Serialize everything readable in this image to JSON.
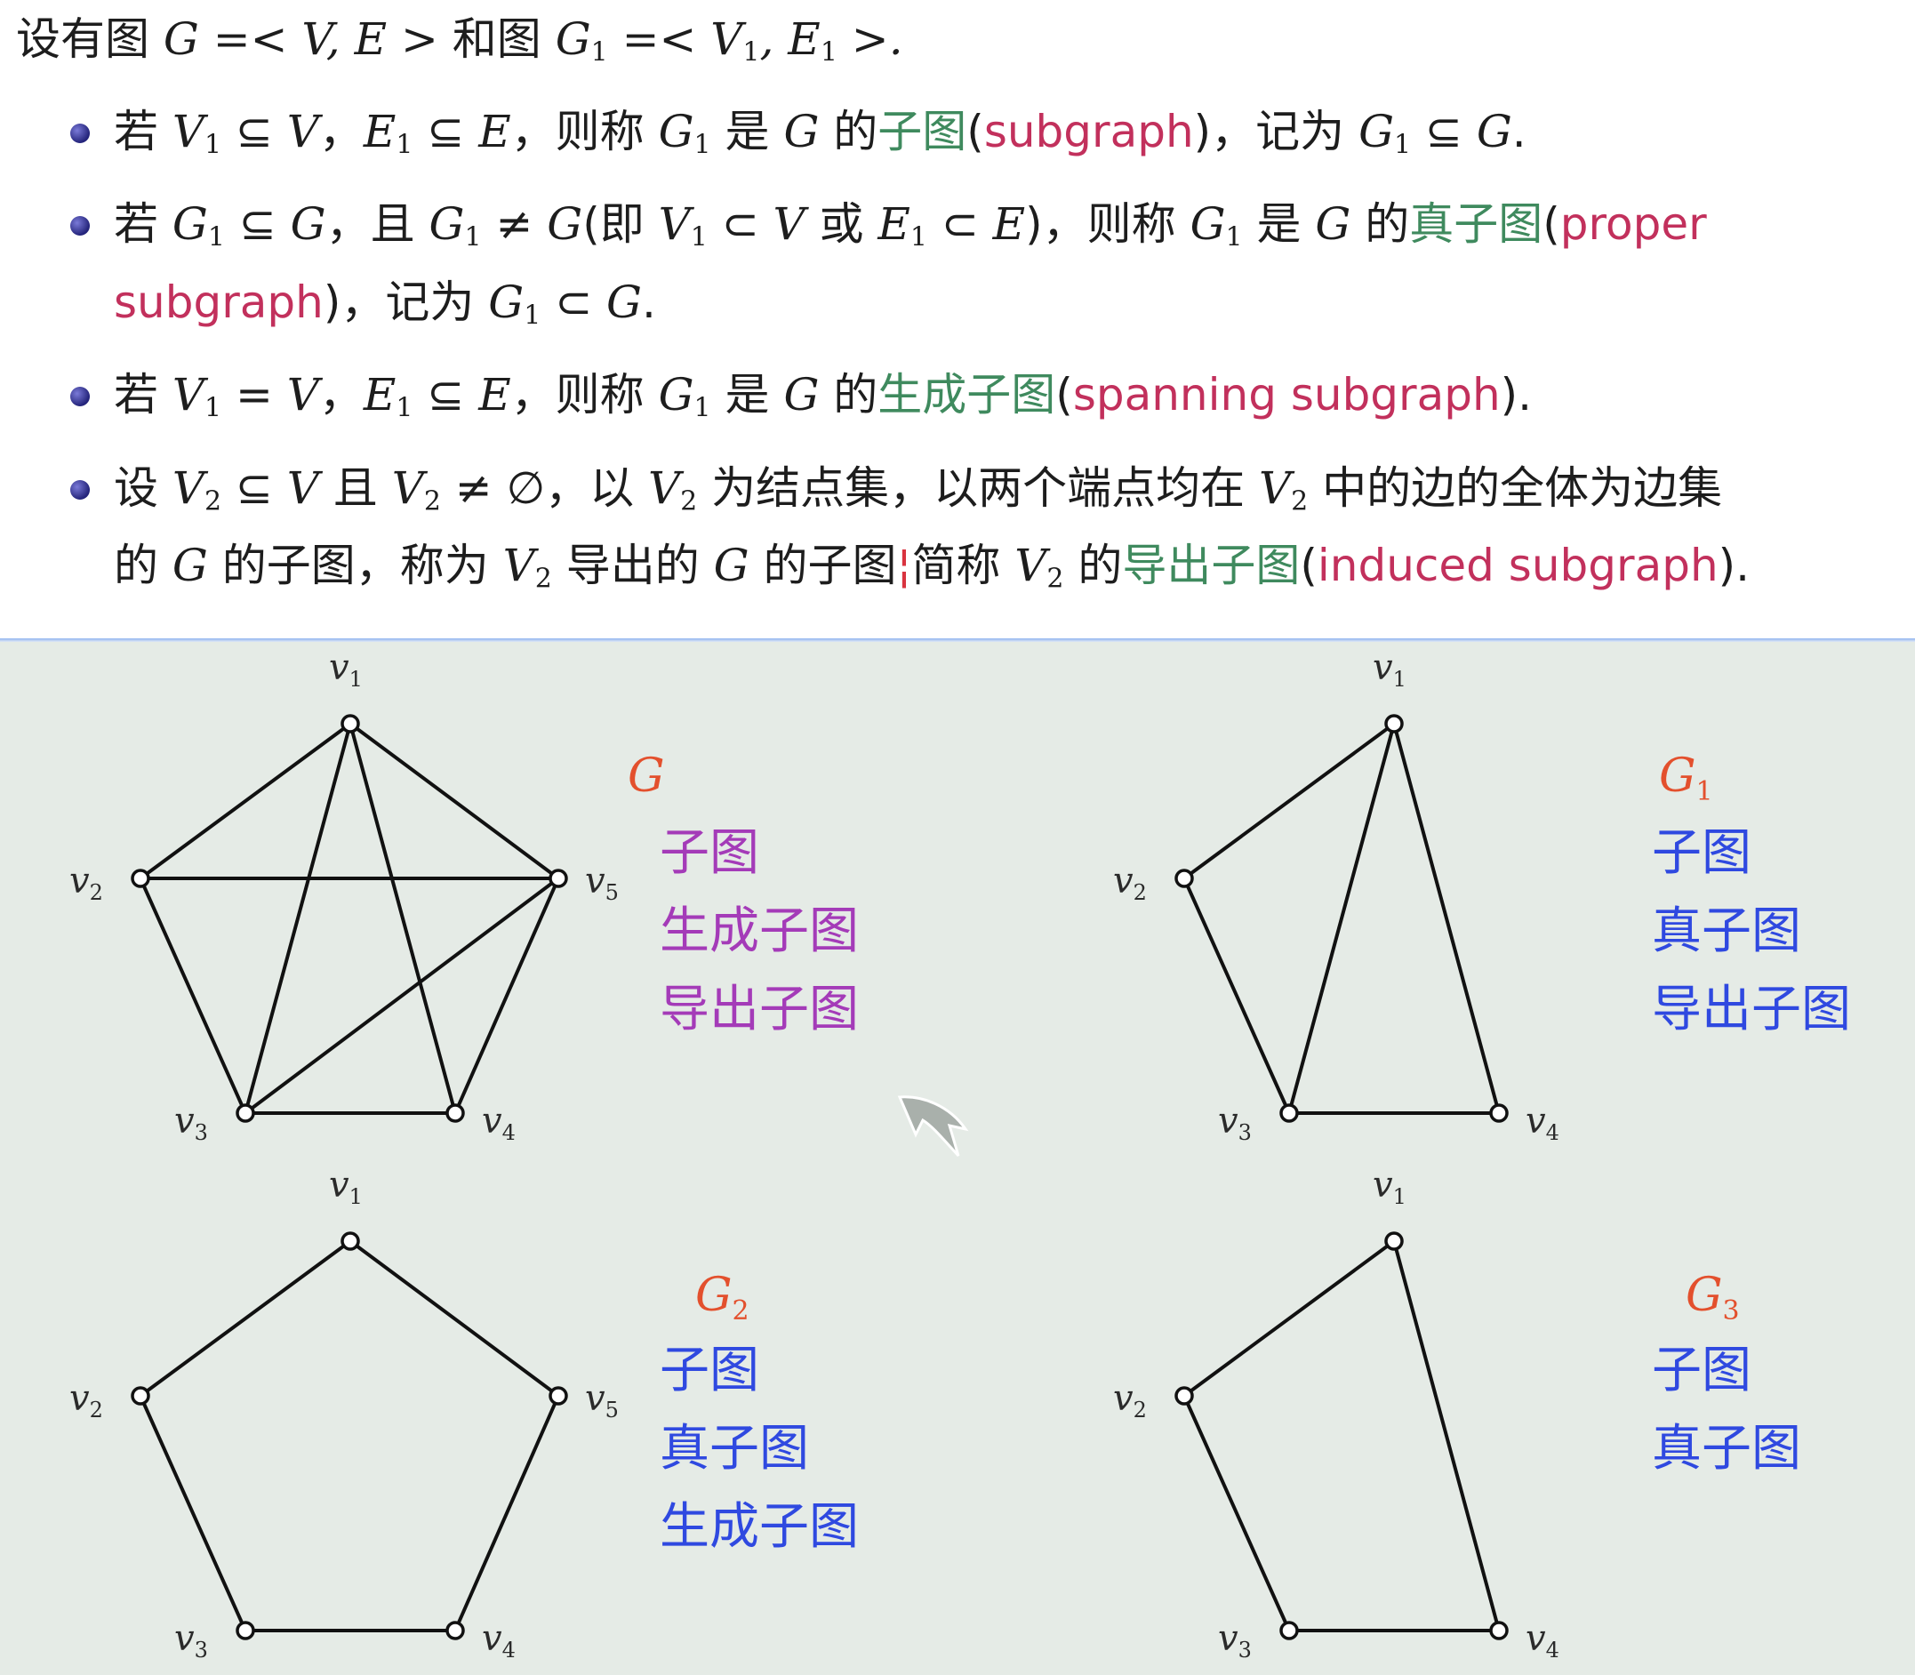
{
  "definition": {
    "intro": {
      "prefix": "设有图",
      "g_def": "G =< V, E >",
      "and": "和图",
      "g1_def_a": "G",
      "g1_sub": "1",
      "g1_def_b": " =< V",
      "g1_sub2": "1",
      "g1_def_c": ", E",
      "g1_sub3": "1",
      "g1_def_d": " >."
    },
    "items": [
      {
        "p1": "若 ",
        "m1": "V",
        "s1": "1",
        "p2": " ⊆ ",
        "m2": "V",
        "p3": "，",
        "m3": "E",
        "s3": "1",
        "p4": " ⊆ ",
        "m4": "E",
        "p5": "，则称 ",
        "m5": "G",
        "s5": "1",
        "p6": " 是 ",
        "m6": "G",
        "p7": " 的",
        "term": "子图",
        "eng_open": "(",
        "eng": "subgraph",
        "eng_close": ")",
        "p8": "，记为 ",
        "m8": "G",
        "s8": "1",
        "p9": " ⊆ ",
        "m9": "G",
        "p10": "."
      },
      {
        "line1": {
          "p1": "若 ",
          "m1": "G",
          "s1": "1",
          "p2": " ⊆ ",
          "m2": "G",
          "p3": "，且 ",
          "m3": "G",
          "s3": "1",
          "p4": " ≠ ",
          "m4": "G",
          "p5": "(即 ",
          "m5": "V",
          "s5": "1",
          "p6": " ⊂ ",
          "m6": "V",
          "p7": " 或 ",
          "m7": "E",
          "s7": "1",
          "p8": " ⊂ ",
          "m8": "E",
          "p9": ")，则称 ",
          "m9": "G",
          "s9": "1",
          "p10": " 是 ",
          "m10": "G",
          "p11": " 的",
          "term": "真子图",
          "eng_open": "(",
          "eng": "proper"
        },
        "line2": {
          "eng": "subgraph",
          "eng_close": ")",
          "p1": "，记为 ",
          "m1": "G",
          "s1": "1",
          "p2": " ⊂ ",
          "m2": "G",
          "p3": "."
        }
      },
      {
        "p1": "若 ",
        "m1": "V",
        "s1": "1",
        "p2": " = ",
        "m2": "V",
        "p3": "，",
        "m3": "E",
        "s3": "1",
        "p4": " ⊆ ",
        "m4": "E",
        "p5": "，则称 ",
        "m5": "G",
        "s5": "1",
        "p6": " 是 ",
        "m6": "G",
        "p7": " 的",
        "term": "生成子图",
        "eng_open": "(",
        "eng": "spanning subgraph",
        "eng_close": ")."
      },
      {
        "line1": {
          "p1": "设 ",
          "m1": "V",
          "s1": "2",
          "p2": " ⊆ ",
          "m2": "V",
          "p3": " 且 ",
          "m3": "V",
          "s3": "2",
          "p4": " ≠ ∅，以 ",
          "m4": "V",
          "s4": "2",
          "p5": " 为结点集，以两个端点均在 ",
          "m5": "V",
          "s5": "2",
          "p6": " 中的边的全体为边集"
        },
        "line2": {
          "p1": "的 ",
          "m1": "G",
          "p2": " 的子图，称为 ",
          "m2": "V",
          "s2": "2",
          "p3": " 导出的 ",
          "m3": "G",
          "p4": " 的子图",
          "mark": "¦",
          "p5": "简称 ",
          "m5": "V",
          "s5": "2",
          "p6": " 的",
          "term": "导出子图",
          "eng_open": "(",
          "eng": "induced subgraph",
          "eng_close": ")."
        }
      }
    ]
  },
  "vertex_labels": {
    "letter": "v",
    "subs": [
      "1",
      "2",
      "3",
      "4",
      "5"
    ]
  },
  "graphs": [
    {
      "name": "G",
      "name_sub": "",
      "vertices": [
        "v1",
        "v2",
        "v3",
        "v4",
        "v5"
      ],
      "edges": [
        [
          "v1",
          "v2"
        ],
        [
          "v1",
          "v3"
        ],
        [
          "v1",
          "v4"
        ],
        [
          "v1",
          "v5"
        ],
        [
          "v2",
          "v5"
        ],
        [
          "v2",
          "v3"
        ],
        [
          "v3",
          "v4"
        ],
        [
          "v3",
          "v5"
        ],
        [
          "v4",
          "v5"
        ]
      ],
      "labels": [
        "子图",
        "生成子图",
        "导出子图"
      ],
      "label_color": "#a43bb8"
    },
    {
      "name": "G",
      "name_sub": "1",
      "vertices": [
        "v1",
        "v2",
        "v3",
        "v4"
      ],
      "edges": [
        [
          "v1",
          "v2"
        ],
        [
          "v1",
          "v3"
        ],
        [
          "v1",
          "v4"
        ],
        [
          "v2",
          "v3"
        ],
        [
          "v3",
          "v4"
        ]
      ],
      "labels": [
        "子图",
        "真子图",
        "导出子图"
      ],
      "label_color": "#2f49e0"
    },
    {
      "name": "G",
      "name_sub": "2",
      "vertices": [
        "v1",
        "v2",
        "v3",
        "v4",
        "v5"
      ],
      "edges": [
        [
          "v1",
          "v2"
        ],
        [
          "v1",
          "v5"
        ],
        [
          "v2",
          "v3"
        ],
        [
          "v3",
          "v4"
        ],
        [
          "v4",
          "v5"
        ]
      ],
      "labels": [
        "子图",
        "真子图",
        "生成子图"
      ],
      "label_color": "#2f49e0"
    },
    {
      "name": "G",
      "name_sub": "3",
      "vertices": [
        "v1",
        "v2",
        "v3",
        "v4"
      ],
      "edges": [
        [
          "v1",
          "v2"
        ],
        [
          "v1",
          "v4"
        ],
        [
          "v2",
          "v3"
        ],
        [
          "v3",
          "v4"
        ]
      ],
      "labels": [
        "子图",
        "真子图"
      ],
      "label_color": "#2f49e0"
    }
  ],
  "colors": {
    "term": "#3f8a5e",
    "english": "#c2305c",
    "graph_name": "#e3502d",
    "figure_background": "#e5ebe6"
  },
  "icons": [
    "bullet-icon",
    "mouse-pointer-icon"
  ]
}
